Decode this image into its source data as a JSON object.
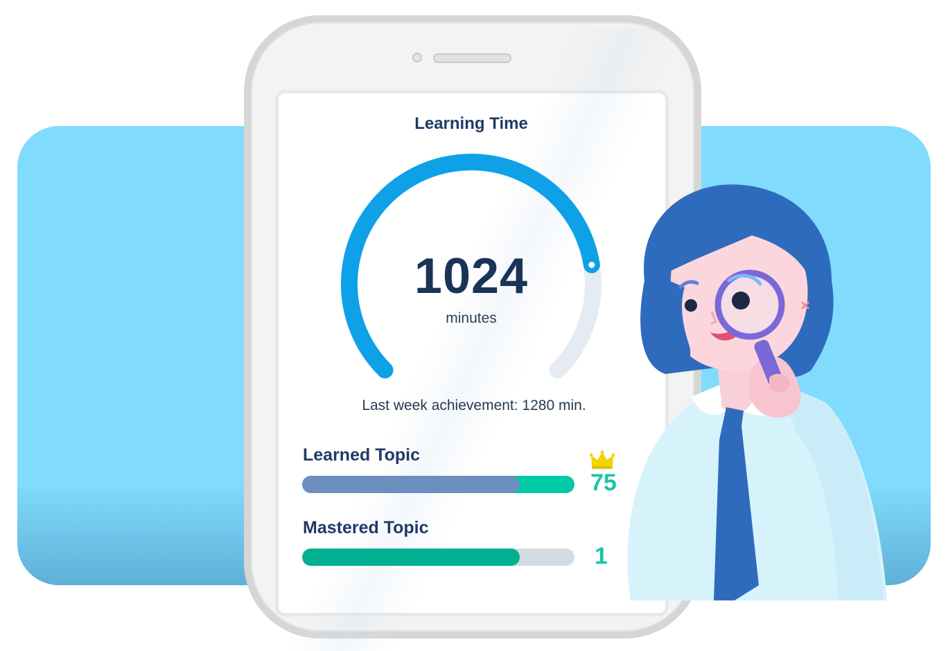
{
  "learning_time": {
    "title": "Learning Time",
    "value": "1024",
    "unit": "minutes",
    "last_week": "Last week achievement: 1280 min.",
    "progress_fraction": 0.8
  },
  "learned_topic": {
    "label": "Learned Topic",
    "score": "75",
    "fill_fraction": 0.8,
    "accent_fraction": 0.2,
    "crown_icon": "crown-icon"
  },
  "mastered_topic": {
    "label": "Mastered Topic",
    "score": "1",
    "fill_fraction": 0.8
  },
  "colors": {
    "background_panel": "#80dbfd",
    "gauge_active": "#0ea1e8",
    "gauge_track": "#e4ebf3",
    "learned_bar": "#6c8fbf",
    "learned_accent": "#00c9a7",
    "mastered_bar": "#00b08f",
    "track": "#d3dbe3",
    "score_text": "#18c7a4",
    "title_text": "#1f3b66"
  }
}
